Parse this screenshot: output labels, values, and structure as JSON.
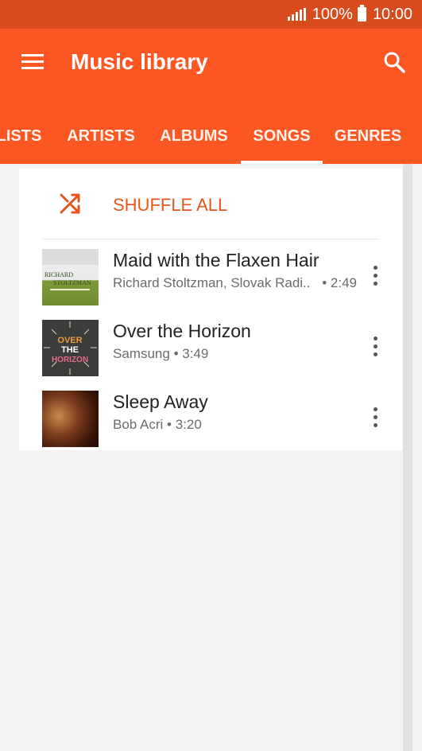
{
  "status": {
    "battery": "100%",
    "time": "10:00"
  },
  "app_bar": {
    "title": "Music library"
  },
  "tabs": [
    {
      "label": "LISTS"
    },
    {
      "label": "ARTISTS"
    },
    {
      "label": "ALBUMS"
    },
    {
      "label": "SONGS",
      "active": true
    },
    {
      "label": "GENRES"
    }
  ],
  "shuffle": {
    "label": "SHUFFLE ALL"
  },
  "songs": [
    {
      "title": "Maid with the Flaxen Hair",
      "artist": "Richard Stoltzman, Slovak Radi..",
      "duration": "• 2:49",
      "art_text": [
        "RICHARD",
        "STOLTZMAN"
      ]
    },
    {
      "title": "Over the Horizon",
      "artist": "Samsung",
      "duration": "• 3:49",
      "art_text": [
        "OVER",
        "THE",
        "HORIZON"
      ]
    },
    {
      "title": "Sleep Away",
      "artist": "Bob Acri",
      "duration": "• 3:20"
    }
  ],
  "colors": {
    "accent": "#fc5722",
    "status_bar": "#d84b1c",
    "shuffle_text": "#e4561e"
  }
}
